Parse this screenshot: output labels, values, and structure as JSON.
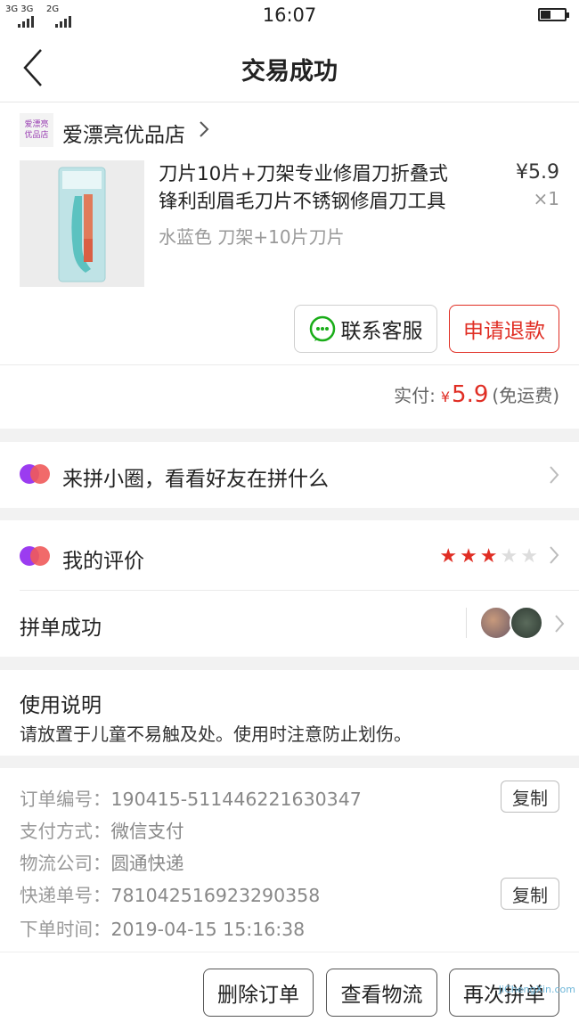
{
  "status": {
    "signal1": "3G 3G",
    "signal2": "2G",
    "time": "16:07"
  },
  "header": {
    "title": "交易成功"
  },
  "shop": {
    "logo_text_1": "爱漂亮",
    "logo_text_2": "优品店",
    "name": "爱漂亮优品店"
  },
  "product": {
    "title_line1": "刀片10片+刀架专业修眉刀折叠式",
    "title_line2": "锋利刮眉毛刀片不锈钢修眉刀工具",
    "sku": "水蓝色 刀架+10片刀片",
    "price": "¥5.9",
    "qty": "×1"
  },
  "actions": {
    "contact_service": "联系客服",
    "refund": "申请退款"
  },
  "payment": {
    "label": "实付:",
    "currency": "¥",
    "amount": "5.9",
    "shipping": "(免运费)"
  },
  "circle": {
    "label": "来拼小圈，看看好友在拼什么"
  },
  "review": {
    "label": "我的评价",
    "rating": 3,
    "max_rating": 5
  },
  "group": {
    "label": "拼单成功"
  },
  "usage": {
    "title": "使用说明",
    "text": "请放置于儿童不易触及处。使用时注意防止划伤。"
  },
  "order_info": [
    {
      "label": "订单编号：",
      "value": "190415-511446221630347",
      "copy": "复制"
    },
    {
      "label": "支付方式：",
      "value": "微信支付"
    },
    {
      "label": "物流公司：",
      "value": "圆通快递"
    },
    {
      "label": "快递单号：",
      "value": "781042516923290358",
      "copy": "复制"
    },
    {
      "label": "下单时间：",
      "value": "2019-04-15 15:16:38"
    }
  ],
  "bottom": {
    "delete": "删除订单",
    "logistics": "查看物流",
    "regroup": "再次拼单"
  },
  "watermark": {
    "text": "JiChengXin.com"
  },
  "colors": {
    "accent": "#e02e24",
    "wechat_green": "#1aad19",
    "pin_purple": "#9b3cf0"
  },
  "icons": {
    "back": "chevron-left-icon",
    "service": "wechat-chat-icon",
    "pin": "pinduoduo-circle-icon"
  }
}
